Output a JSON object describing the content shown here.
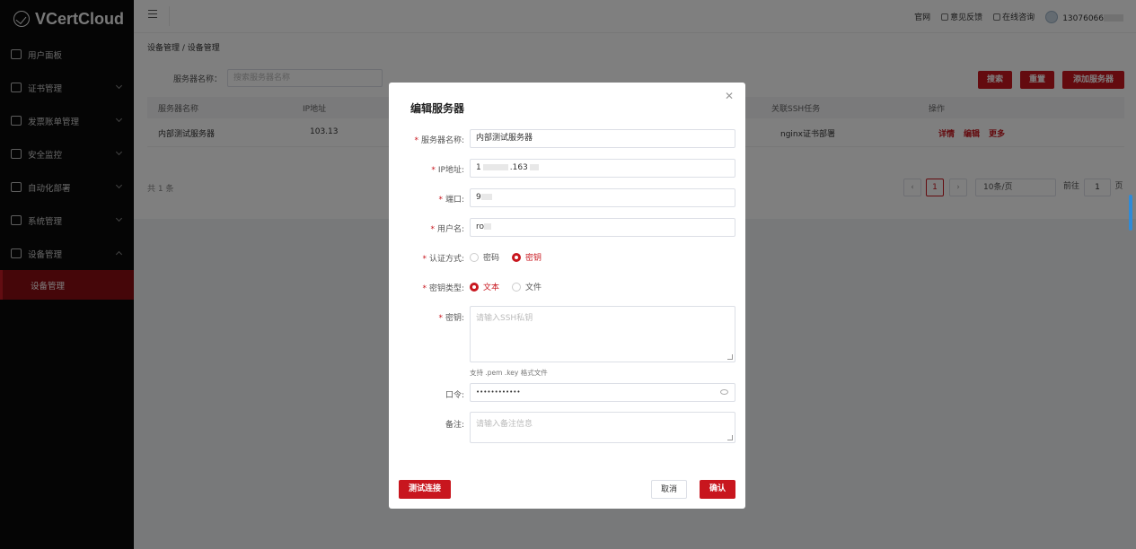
{
  "sidebar": {
    "logo": "VCertCloud",
    "items": [
      {
        "label": "用户面板"
      },
      {
        "label": "证书管理"
      },
      {
        "label": "发票账单管理"
      },
      {
        "label": "安全监控"
      },
      {
        "label": "自动化部署"
      },
      {
        "label": "系统管理"
      },
      {
        "label": "设备管理"
      }
    ],
    "sub_item": "设备管理"
  },
  "topbar": {
    "link_site": "官网",
    "link_feedback": "意见反馈",
    "link_consult": "在线咨询",
    "user": "13076066"
  },
  "page": {
    "breadcrumb": "设备管理 / 设备管理",
    "search_label": "服务器名称：",
    "search_placeholder": "搜索服务器名称",
    "btn_search": "搜索",
    "btn_reset": "重置",
    "btn_add": "添加服务器",
    "columns": [
      "服务器名称",
      "IP地址",
      "关联SSH任务",
      "操作"
    ],
    "row": {
      "name": "内部测试服务器",
      "ip": "103.13",
      "task": "nginx证书部署",
      "op_detail": "详情",
      "op_edit": "编辑",
      "op_more": "更多"
    },
    "total": "共 1 条",
    "pager": {
      "current": "1",
      "page_size": "10条/页",
      "goto_label": "前往",
      "goto_value": "1",
      "page_unit": "页"
    }
  },
  "dialog": {
    "title": "编辑服务器",
    "name_label": "服务器名称:",
    "name_value": "内部测试服务器",
    "ip_label": "IP地址:",
    "ip_value_a": "1",
    "ip_value_b": ".163",
    "port_label": "端口:",
    "port_value": "9",
    "user_label": "用户名:",
    "user_value": "ro",
    "auth_label": "认证方式:",
    "auth_options": [
      "密码",
      "密钥"
    ],
    "keytype_label": "密钥类型:",
    "keytype_options": [
      "文本",
      "文件"
    ],
    "key_label": "密钥:",
    "key_placeholder": "请输入SSH私钥",
    "key_hint": "支持 .pem .key 格式文件",
    "pass_label": "口令:",
    "pass_value": "••••••••••••",
    "note_label": "备注:",
    "note_placeholder": "请输入备注信息",
    "btn_test": "测试连接",
    "btn_cancel": "取消",
    "btn_confirm": "确认"
  },
  "colors": {
    "accent": "#c8161e",
    "sidebar": "#0a0a0a",
    "active_sub": "#8b0c12"
  }
}
